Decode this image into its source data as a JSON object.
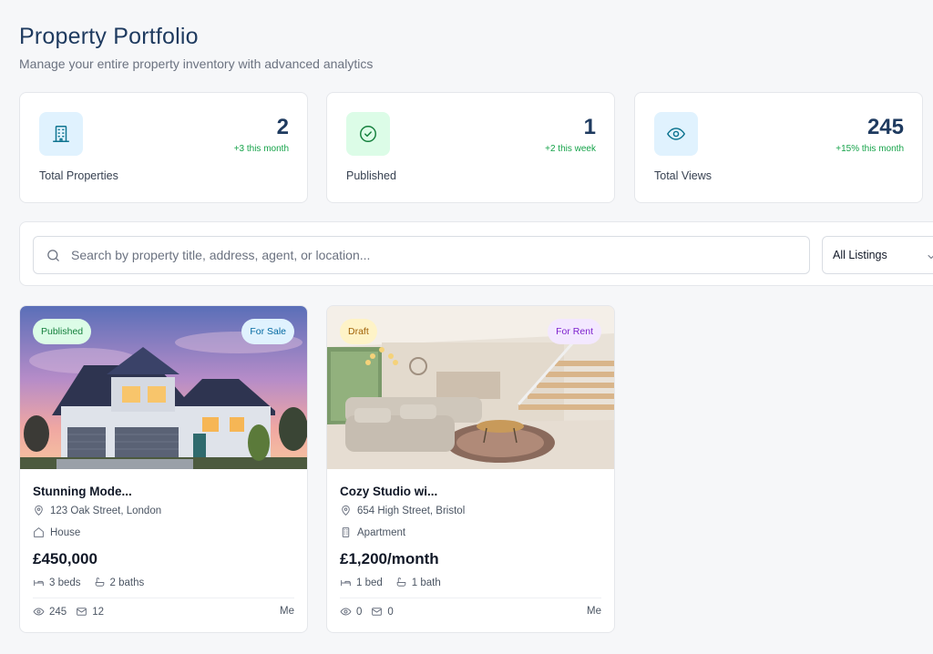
{
  "header": {
    "title": "Property Portfolio",
    "subtitle": "Manage your entire property inventory with advanced analytics"
  },
  "stats": [
    {
      "label": "Total Properties",
      "value": "2",
      "delta": "+3 this month",
      "icon": "building-icon",
      "icon_bg": "#e0f2fe",
      "icon_color": "#0e7490"
    },
    {
      "label": "Published",
      "value": "1",
      "delta": "+2 this week",
      "icon": "check-circle-icon",
      "icon_bg": "#dcfce7",
      "icon_color": "#15803d"
    },
    {
      "label": "Total Views",
      "value": "245",
      "delta": "+15% this month",
      "icon": "eye-icon",
      "icon_bg": "#e0f2fe",
      "icon_color": "#0e7490"
    }
  ],
  "search": {
    "placeholder": "Search by property title, address, agent, or location...",
    "value": ""
  },
  "filter": {
    "selected": "All Listings"
  },
  "listings": [
    {
      "status": "Published",
      "listing_type": "For Sale",
      "title": "Stunning Mode...",
      "address": "123 Oak Street, London",
      "property_type": "House",
      "price": "£450,000",
      "beds": "3 beds",
      "baths": "2 baths",
      "views": "245",
      "messages": "12",
      "owner": "Me"
    },
    {
      "status": "Draft",
      "listing_type": "For Rent",
      "title": "Cozy Studio wi...",
      "address": "654 High Street, Bristol",
      "property_type": "Apartment",
      "price": "£1,200/month",
      "beds": "1 bed",
      "baths": "1 bath",
      "views": "0",
      "messages": "0",
      "owner": "Me"
    }
  ],
  "colors": {
    "accent": "#1e3a5f",
    "positive": "#16a34a",
    "badge_published_bg": "#dcfce7",
    "badge_published_text": "#15803d",
    "badge_draft_bg": "#fef3c7",
    "badge_draft_text": "#a16207",
    "badge_sale_bg": "#e0f2fe",
    "badge_sale_text": "#0369a1",
    "badge_rent_bg": "#f3e8ff",
    "badge_rent_text": "#7e22ce"
  }
}
